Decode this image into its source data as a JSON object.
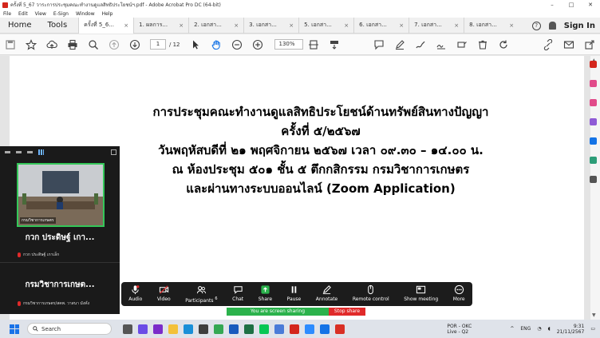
{
  "window": {
    "title": "ครั้งที่ 5_67 วาระการประชุมคณะทำงานดูแลสิทธิประโยชน์ฯ.pdf - Adobe Acrobat Pro DC (64-bit)",
    "minimize": "–",
    "maximize": "□",
    "close": "✕"
  },
  "menu": [
    "File",
    "Edit",
    "View",
    "E-Sign",
    "Window",
    "Help"
  ],
  "tabs": {
    "home": "Home",
    "tools": "Tools",
    "docs": [
      {
        "label": "ครั้งที่ 5_6...",
        "active": true
      },
      {
        "label": "1. ผลการ...",
        "active": false
      },
      {
        "label": "2. เอกสา...",
        "active": false
      },
      {
        "label": "3. เอกสา...",
        "active": false
      },
      {
        "label": "5. เอกสา...",
        "active": false
      },
      {
        "label": "6. เอกสา...",
        "active": false
      },
      {
        "label": "7. เอกสา...",
        "active": false
      },
      {
        "label": "8. เอกสา...",
        "active": false
      }
    ],
    "close_glyph": "×",
    "help": "?",
    "sign_in": "Sign In"
  },
  "toolbar": {
    "page_current": "1",
    "page_total": "/ 12",
    "zoom": "130%"
  },
  "document": {
    "lines": [
      "การประชุมคณะทำงานดูแลสิทธิประโยชน์ด้านทรัพย์สินทางปัญญา",
      "ครั้งที่ ๕/๒๕๖๗",
      "วันพฤหัสบดีที่ ๒๑ พฤศจิกายน ๒๕๖๗ เวลา ๐๙.๓๐ – ๑๔.๐๐ น.",
      "ณ ห้องประชุม ๕๐๑ ชั้น ๕ ตึกกสิกรรม กรมวิชาการเกษตร",
      "และผ่านทางระบบออนไลน์ (Zoom Application)"
    ]
  },
  "zoom_panel": {
    "video_label": "กรมวิชาการเกษตร",
    "tile1_name": "กวก ประดิษฐ์ เกา...",
    "tile1_sub": "กวก ประดิษฐ์ เกาเล็ก",
    "tile2_name": "กรมวิชาการเกษต...",
    "tile2_sub": "กรมวิชาการเกษตร/สคพ. วาสนา มังคั่ง"
  },
  "zoom_bar": {
    "items": [
      {
        "label": "Audio",
        "icon": "mic-icon"
      },
      {
        "label": "Video",
        "icon": "video-off-icon"
      },
      {
        "label": "Participants",
        "icon": "participants-icon",
        "count": "6"
      },
      {
        "label": "Chat",
        "icon": "chat-icon"
      },
      {
        "label": "Share",
        "icon": "share-icon"
      },
      {
        "label": "Pause",
        "icon": "pause-icon"
      },
      {
        "label": "Annotate",
        "icon": "annotate-icon"
      },
      {
        "label": "Remote control",
        "icon": "remote-control-icon"
      },
      {
        "label": "Show meeting",
        "icon": "show-meeting-icon"
      },
      {
        "label": "More",
        "icon": "more-icon"
      }
    ],
    "sharing_text": "You are screen sharing",
    "stop_share": "Stop share"
  },
  "taskbar": {
    "search": "Search",
    "weather_line1": "POR - OKC",
    "weather_line2": "Live - Q2",
    "lang": "ENG",
    "time": "9:31",
    "date": "21/11/2567"
  },
  "colors": {
    "accent_green": "#2bb24c",
    "stop_red": "#e02a2a",
    "acrobat_red": "#d4261c"
  }
}
